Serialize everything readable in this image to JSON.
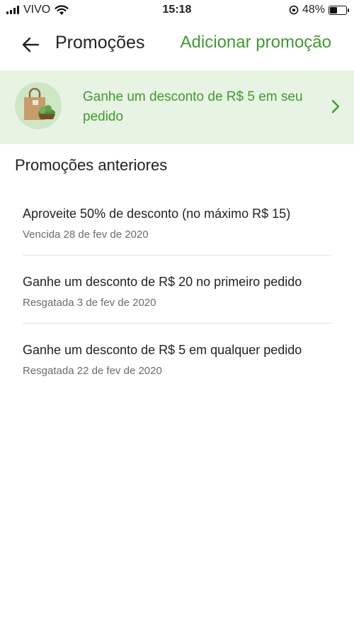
{
  "status_bar": {
    "carrier": "VIVO",
    "time": "15:18",
    "battery_percent": "48%",
    "battery_level": 0.48
  },
  "header": {
    "title": "Promoções",
    "action_label": "Adicionar promoção",
    "back_icon": "arrow-left-icon"
  },
  "banner": {
    "text": "Ganhe um desconto de R$ 5 em seu pedido",
    "icon": "grocery-bag-icon",
    "accent_color": "#3f9a2f",
    "background": "#e8f4e3"
  },
  "previous": {
    "title": "Promoções anteriores",
    "items": [
      {
        "title": "Aproveite 50% de desconto (no máximo R$ 15)",
        "status": "Vencida 28 de fev de 2020"
      },
      {
        "title": "Ganhe um desconto de R$ 20 no primeiro pedido",
        "status": "Resgatada 3 de fev de 2020"
      },
      {
        "title": "Ganhe um desconto de R$ 5 em qualquer pedido",
        "status": "Resgatada 22 de fev de 2020"
      }
    ]
  }
}
